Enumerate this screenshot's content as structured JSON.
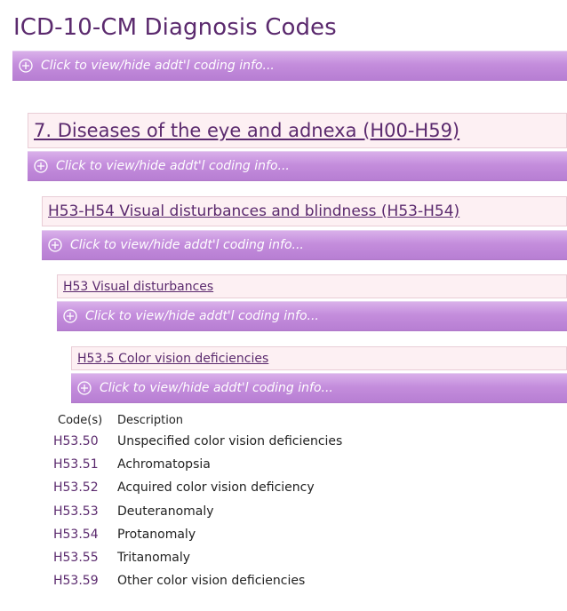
{
  "page": {
    "title": "ICD-10-CM Diagnosis Codes"
  },
  "toggle_label": "Click to view/hide addt'l coding info...",
  "hierarchy": [
    {
      "label": "7. Diseases of the eye and adnexa (H00-H59)"
    },
    {
      "label": "H53-H54 Visual disturbances and blindness (H53-H54)"
    },
    {
      "label": "H53 Visual disturbances"
    },
    {
      "label": "H53.5 Color vision deficiencies"
    }
  ],
  "table": {
    "headers": {
      "code": "Code(s)",
      "description": "Description"
    },
    "rows": [
      {
        "code": "H53.50",
        "description": "Unspecified color vision deficiencies"
      },
      {
        "code": "H53.51",
        "description": "Achromatopsia"
      },
      {
        "code": "H53.52",
        "description": "Acquired color vision deficiency"
      },
      {
        "code": "H53.53",
        "description": "Deuteranomaly"
      },
      {
        "code": "H53.54",
        "description": "Protanomaly"
      },
      {
        "code": "H53.55",
        "description": "Tritanomaly"
      },
      {
        "code": "H53.59",
        "description": "Other color vision deficiencies"
      }
    ]
  },
  "colors": {
    "accent": "#5b2a6e",
    "bar": "#c48ddc",
    "heading_bg": "#fdf0f3"
  }
}
